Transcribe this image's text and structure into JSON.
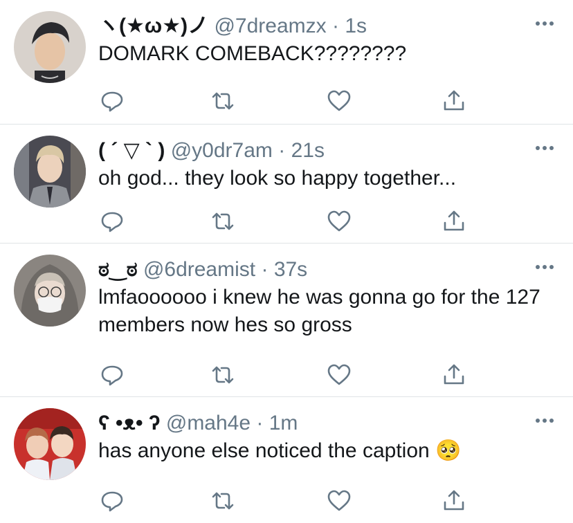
{
  "tweets": [
    {
      "display_name": "ヽ(★ω★)ノ",
      "handle": "@7dreamzx",
      "time": "1s",
      "text": "DOMARK COMEBACK????????",
      "avatar": "avatar-man-dark-hair"
    },
    {
      "display_name": "( ´ ▽ ` )",
      "handle": "@y0dr7am",
      "time": "21s",
      "text": "oh god... they look so happy together...",
      "avatar": "avatar-man-blond-suit"
    },
    {
      "display_name": "ಠ‿ಠ",
      "handle": "@6dreamist",
      "time": "37s",
      "text": "lmfaoooooo i knew he was gonna go for the 127 members now hes so gross",
      "avatar": "avatar-person-mask"
    },
    {
      "display_name": "ʕ •ᴥ• ʔ",
      "handle": "@mah4e",
      "time": "1m",
      "text": "has anyone else noticed the caption 🥺",
      "avatar": "avatar-two-people-red"
    }
  ],
  "colors": {
    "text": "#14171a",
    "meta": "#657786",
    "icon": "#657786",
    "divider": "#dfe3e6"
  },
  "icons": [
    "reply-icon",
    "retweet-icon",
    "like-icon",
    "share-icon",
    "more-options-icon"
  ]
}
